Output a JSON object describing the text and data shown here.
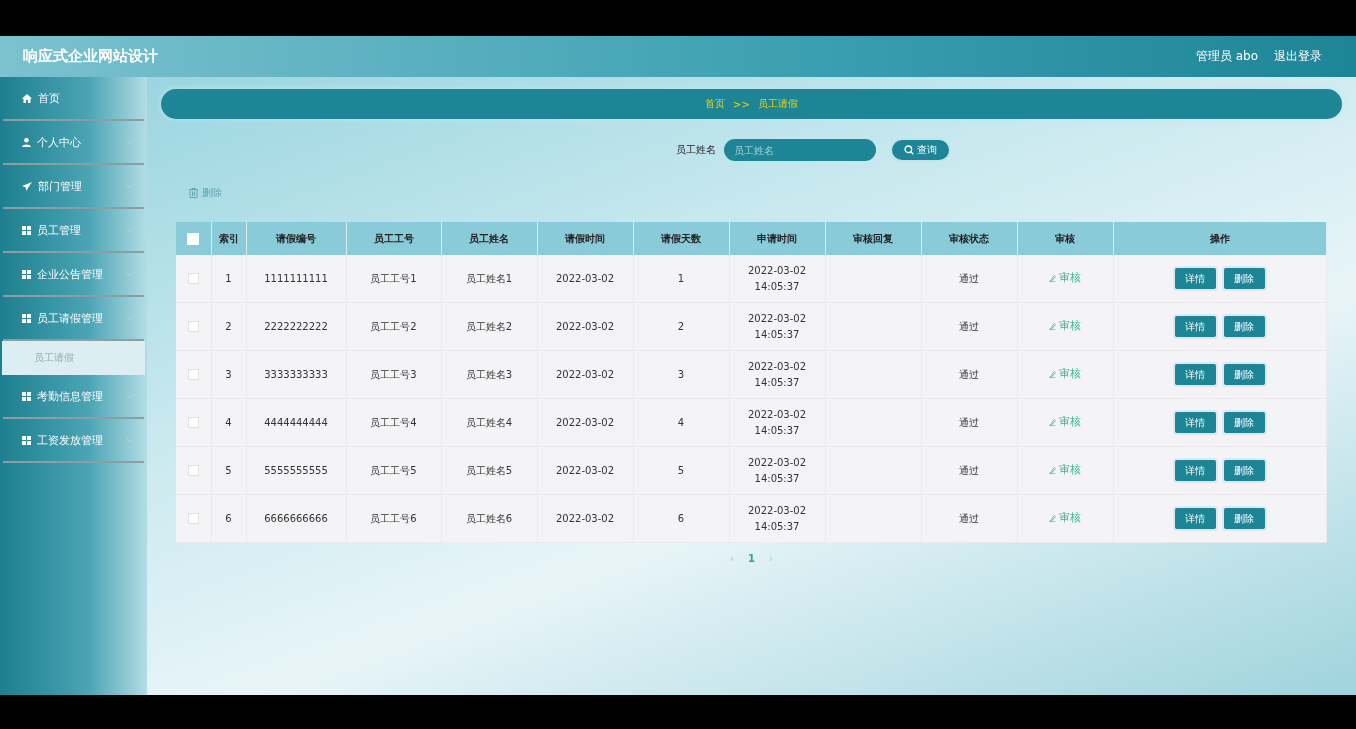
{
  "header": {
    "title": "响应式企业网站设计",
    "user": "管理员 abo",
    "logout": "退出登录"
  },
  "sidebar": {
    "items": [
      {
        "label": "首页",
        "kind": "link"
      },
      {
        "label": "个人中心",
        "kind": "menu"
      },
      {
        "label": "部门管理",
        "kind": "menu"
      },
      {
        "label": "员工管理",
        "kind": "menu"
      },
      {
        "label": "企业公告管理",
        "kind": "menu"
      },
      {
        "label": "员工请假管理",
        "kind": "menu",
        "children": [
          {
            "label": "员工请假",
            "selected": true
          }
        ]
      },
      {
        "label": "考勤信息管理",
        "kind": "menu"
      },
      {
        "label": "工资发放管理",
        "kind": "menu"
      }
    ]
  },
  "breadcrumb": [
    "首页",
    ">>",
    "员工请假"
  ],
  "search": {
    "label": "员工姓名",
    "placeholder": "员工姓名",
    "button": "查询"
  },
  "delete_button": "删除",
  "table": {
    "select_all_checked": false,
    "columns": [
      "索引",
      "请假编号",
      "员工工号",
      "员工姓名",
      "请假时间",
      "请假天数",
      "申请时间",
      "审核回复",
      "审核状态",
      "审核",
      "操作"
    ],
    "rows": [
      {
        "checked": false,
        "cells": [
          "1",
          "1111111111",
          "员工工号1",
          "员工姓名1",
          "2022-03-02",
          "1",
          "2022-03-02 14:05:37",
          "",
          "通过"
        ],
        "review": "审核",
        "actions": [
          "详情",
          "删除"
        ]
      },
      {
        "checked": false,
        "cells": [
          "2",
          "2222222222",
          "员工工号2",
          "员工姓名2",
          "2022-03-02",
          "2",
          "2022-03-02 14:05:37",
          "",
          "通过"
        ],
        "review": "审核",
        "actions": [
          "详情",
          "删除"
        ]
      },
      {
        "checked": false,
        "cells": [
          "3",
          "3333333333",
          "员工工号3",
          "员工姓名3",
          "2022-03-02",
          "3",
          "2022-03-02 14:05:37",
          "",
          "通过"
        ],
        "review": "审核",
        "actions": [
          "详情",
          "删除"
        ]
      },
      {
        "checked": false,
        "cells": [
          "4",
          "4444444444",
          "员工工号4",
          "员工姓名4",
          "2022-03-02",
          "4",
          "2022-03-02 14:05:37",
          "",
          "通过"
        ],
        "review": "审核",
        "actions": [
          "详情",
          "删除"
        ]
      },
      {
        "checked": false,
        "cells": [
          "5",
          "5555555555",
          "员工工号5",
          "员工姓名5",
          "2022-03-02",
          "5",
          "2022-03-02 14:05:37",
          "",
          "通过"
        ],
        "review": "审核",
        "actions": [
          "详情",
          "删除"
        ]
      },
      {
        "checked": false,
        "cells": [
          "6",
          "6666666666",
          "员工工号6",
          "员工姓名6",
          "2022-03-02",
          "6",
          "2022-03-02 14:05:37",
          "",
          "通过"
        ],
        "review": "审核",
        "actions": [
          "详情",
          "删除"
        ]
      }
    ]
  },
  "pagination": {
    "prev": "‹",
    "pages": [
      {
        "label": "1",
        "selected": true
      }
    ],
    "next": "›"
  }
}
